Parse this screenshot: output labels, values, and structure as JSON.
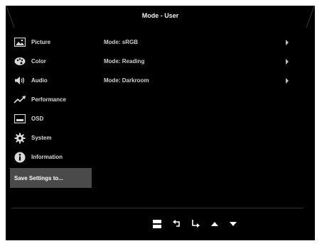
{
  "title": "Mode - User",
  "sidebar": {
    "items": [
      {
        "label": "Picture",
        "icon": "picture-icon"
      },
      {
        "label": "Color",
        "icon": "palette-icon"
      },
      {
        "label": "Audio",
        "icon": "speaker-icon"
      },
      {
        "label": "Performance",
        "icon": "trend-icon"
      },
      {
        "label": "OSD",
        "icon": "osd-icon"
      },
      {
        "label": "System",
        "icon": "gear-icon"
      },
      {
        "label": "Information",
        "icon": "info-icon"
      },
      {
        "label": "Save Settings to...",
        "icon": ""
      }
    ],
    "selected_index": 7
  },
  "modes": [
    {
      "label": "Mode: sRGB"
    },
    {
      "label": "Mode: Reading"
    },
    {
      "label": "Mode: Darkroom"
    }
  ],
  "nav_icons": [
    "menu-icon",
    "back-icon",
    "enter-icon",
    "up-icon",
    "down-icon"
  ],
  "colors": {
    "background": "#000000",
    "selected_item": "#4a4a4a",
    "text": "#d8d8d8"
  }
}
